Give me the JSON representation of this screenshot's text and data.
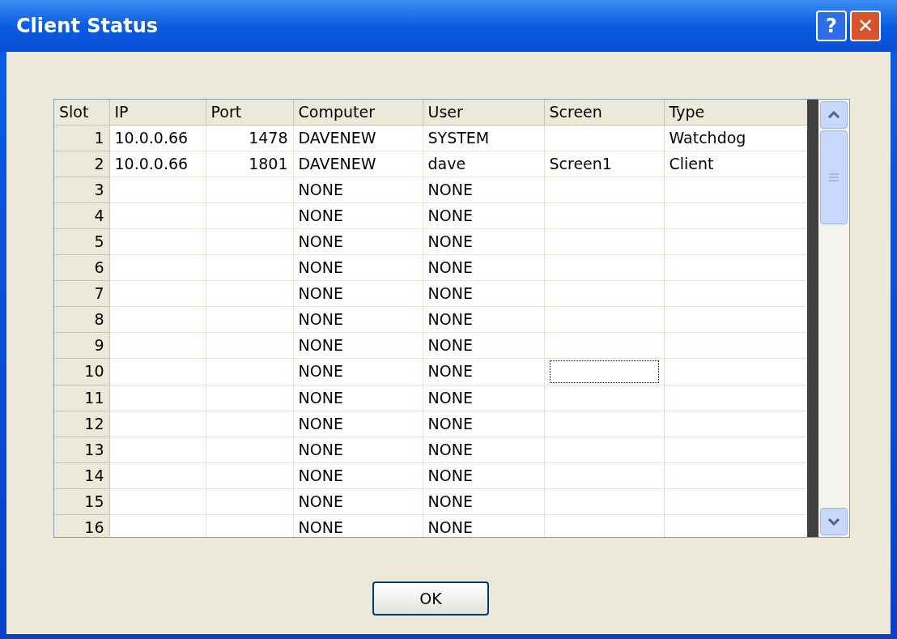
{
  "window": {
    "title": "Client Status",
    "buttons": [
      {
        "kind": "help",
        "label": "?"
      },
      {
        "kind": "close",
        "label": "✕"
      }
    ]
  },
  "grid": {
    "columns": [
      {
        "label": "Slot"
      },
      {
        "label": "IP"
      },
      {
        "label": "Port"
      },
      {
        "label": "Computer"
      },
      {
        "label": "User"
      },
      {
        "label": "Screen"
      },
      {
        "label": "Type"
      }
    ],
    "rows": [
      {
        "cells": [
          "1",
          "10.0.0.66",
          "1478",
          "DAVENEW",
          "SYSTEM",
          "",
          "Watchdog"
        ],
        "focused": false
      },
      {
        "cells": [
          "2",
          "10.0.0.66",
          "1801",
          "DAVENEW",
          "dave",
          "Screen1",
          "Client"
        ],
        "focused": false
      },
      {
        "cells": [
          "3",
          "",
          "",
          "NONE",
          "NONE",
          "",
          ""
        ],
        "focused": false
      },
      {
        "cells": [
          "4",
          "",
          "",
          "NONE",
          "NONE",
          "",
          ""
        ],
        "focused": false
      },
      {
        "cells": [
          "5",
          "",
          "",
          "NONE",
          "NONE",
          "",
          ""
        ],
        "focused": false
      },
      {
        "cells": [
          "6",
          "",
          "",
          "NONE",
          "NONE",
          "",
          ""
        ],
        "focused": false
      },
      {
        "cells": [
          "7",
          "",
          "",
          "NONE",
          "NONE",
          "",
          ""
        ],
        "focused": false
      },
      {
        "cells": [
          "8",
          "",
          "",
          "NONE",
          "NONE",
          "",
          ""
        ],
        "focused": false
      },
      {
        "cells": [
          "9",
          "",
          "",
          "NONE",
          "NONE",
          "",
          ""
        ],
        "focused": false
      },
      {
        "cells": [
          "10",
          "",
          "",
          "NONE",
          "NONE",
          "",
          ""
        ],
        "focused": true
      },
      {
        "cells": [
          "11",
          "",
          "",
          "NONE",
          "NONE",
          "",
          ""
        ],
        "focused": false
      },
      {
        "cells": [
          "12",
          "",
          "",
          "NONE",
          "NONE",
          "",
          ""
        ],
        "focused": false
      },
      {
        "cells": [
          "13",
          "",
          "",
          "NONE",
          "NONE",
          "",
          ""
        ],
        "focused": false
      },
      {
        "cells": [
          "14",
          "",
          "",
          "NONE",
          "NONE",
          "",
          ""
        ],
        "focused": false
      },
      {
        "cells": [
          "15",
          "",
          "",
          "NONE",
          "NONE",
          "",
          ""
        ],
        "focused": false
      },
      {
        "cells": [
          "16",
          "",
          "",
          "NONE",
          "NONE",
          "",
          ""
        ],
        "focused": false
      }
    ]
  },
  "ok_button": "OK"
}
